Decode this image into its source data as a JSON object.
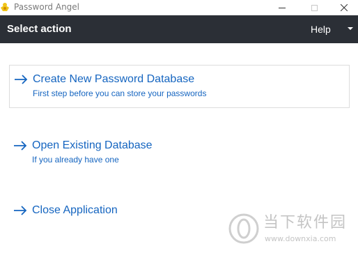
{
  "window": {
    "title": "Password Angel",
    "icon": "app-icon-angel",
    "controls": [
      "minimize-icon",
      "maximize-icon",
      "close-icon"
    ]
  },
  "header": {
    "title": "Select action",
    "help_label": "Help",
    "background": "#2b2f36",
    "text_color": "#ffffff"
  },
  "actions": [
    {
      "title": "Create New Password Database",
      "subtitle": "First step before you can store your passwords",
      "icon": "arrow-right-icon"
    },
    {
      "title": "Open Existing Database",
      "subtitle": "If you already have one",
      "icon": "arrow-right-icon"
    },
    {
      "title": "Close Application",
      "subtitle": "",
      "icon": "arrow-right-icon"
    }
  ],
  "accent_color": "#1565c0",
  "watermark": {
    "text": "当下软件园",
    "url": "www.downxia.com"
  }
}
